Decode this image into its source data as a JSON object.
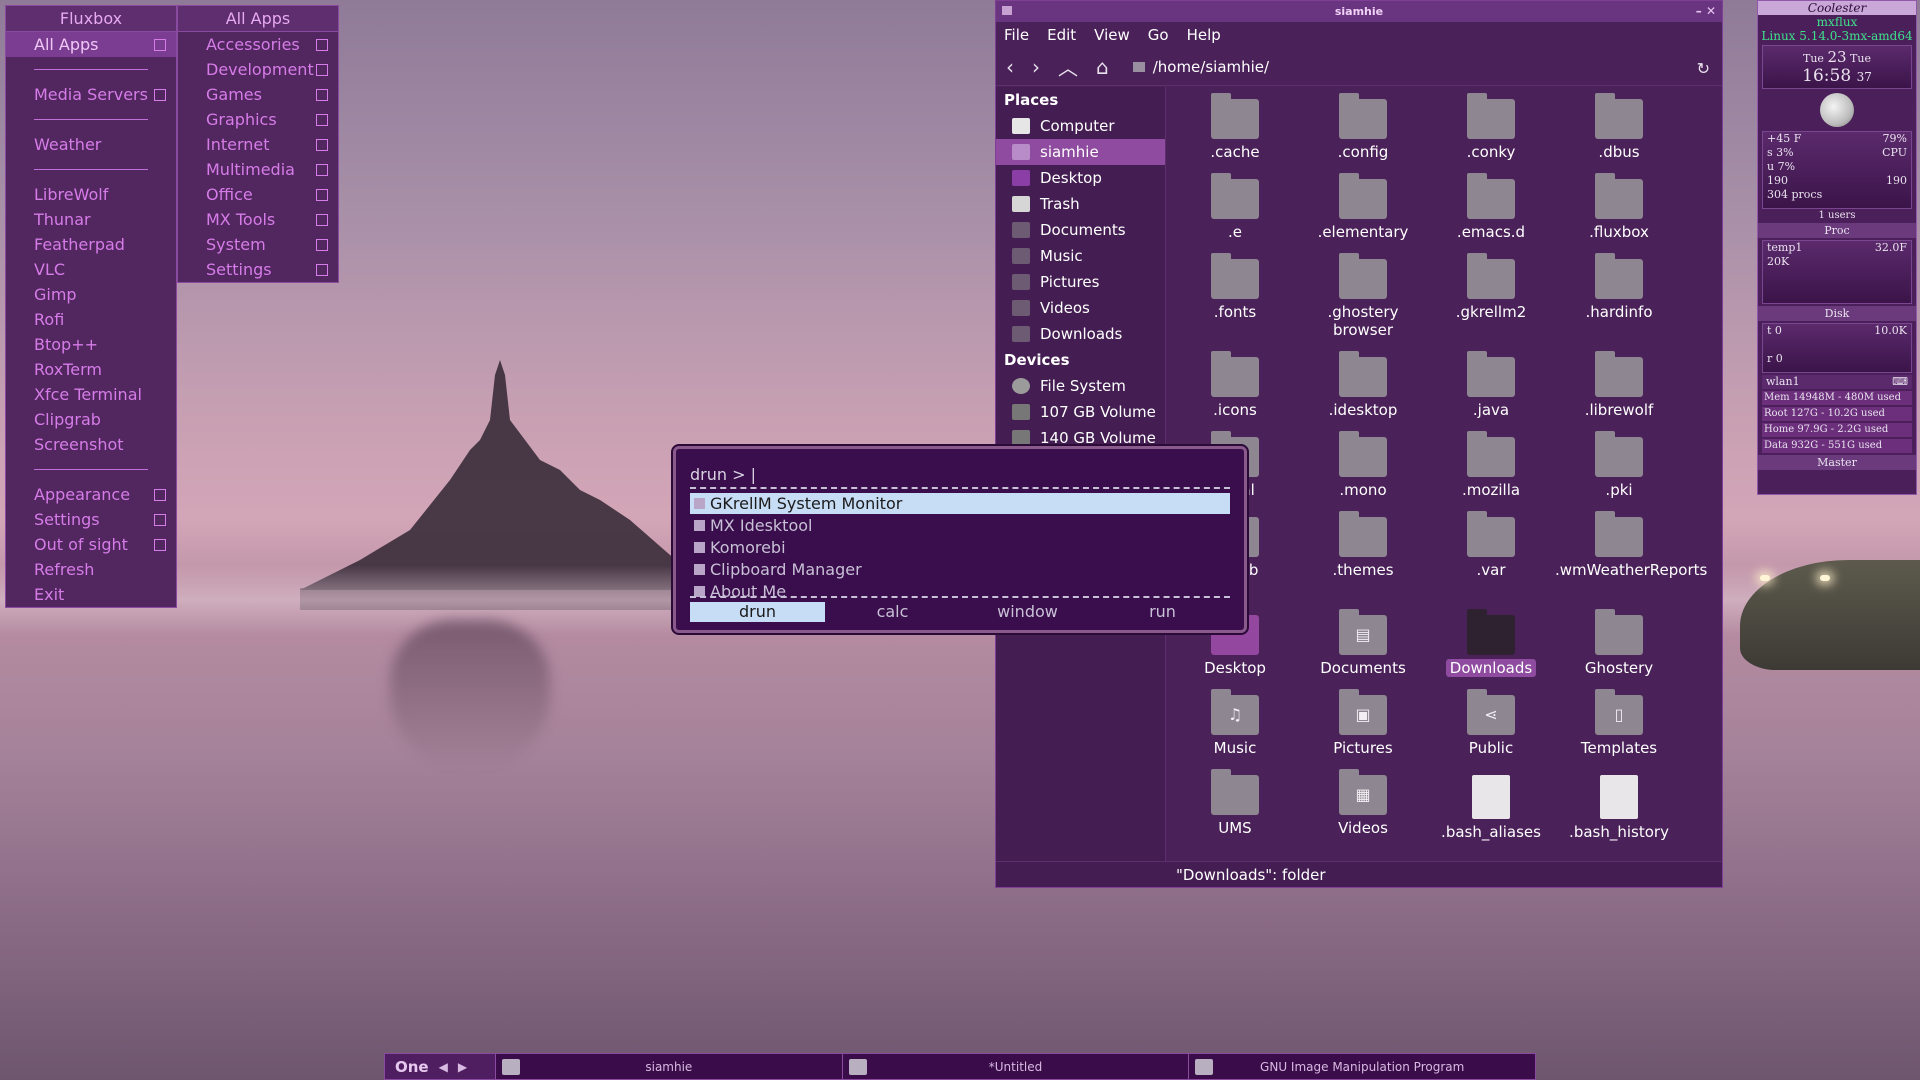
{
  "fluxbox_menu": {
    "title": "Fluxbox",
    "items": [
      {
        "label": "All Apps",
        "sub": true,
        "selected": true
      },
      {
        "sep": true
      },
      {
        "label": "Media Servers",
        "sub": true
      },
      {
        "sep": true
      },
      {
        "label": "Weather"
      },
      {
        "sep": true
      },
      {
        "label": "LibreWolf"
      },
      {
        "label": "Thunar"
      },
      {
        "label": "Featherpad"
      },
      {
        "label": "VLC"
      },
      {
        "label": "Gimp"
      },
      {
        "label": "Rofi"
      },
      {
        "label": "Btop++"
      },
      {
        "label": "RoxTerm"
      },
      {
        "label": "Xfce Terminal"
      },
      {
        "label": "Clipgrab"
      },
      {
        "label": "Screenshot"
      },
      {
        "sep": true
      },
      {
        "label": "Appearance",
        "sub": true
      },
      {
        "label": "Settings",
        "sub": true
      },
      {
        "label": "Out of sight",
        "sub": true
      },
      {
        "label": "Refresh"
      },
      {
        "label": "Exit"
      }
    ]
  },
  "allapps_menu": {
    "title": "All Apps",
    "items": [
      "Accessories",
      "Development",
      "Games",
      "Graphics",
      "Internet",
      "Multimedia",
      "Office",
      "MX Tools",
      "System",
      "Settings"
    ]
  },
  "file_manager": {
    "window_title": "siamhie",
    "menubar": [
      "File",
      "Edit",
      "View",
      "Go",
      "Help"
    ],
    "path": "/home/siamhie/",
    "places_heading": "Places",
    "places": [
      {
        "label": "Computer",
        "icon": "computer-icon"
      },
      {
        "label": "siamhie",
        "icon": "home-icon",
        "selected": true
      },
      {
        "label": "Desktop",
        "icon": "desktop-icon"
      },
      {
        "label": "Trash",
        "icon": "trash-icon"
      },
      {
        "label": "Documents",
        "icon": "folder-icon"
      },
      {
        "label": "Music",
        "icon": "folder-icon"
      },
      {
        "label": "Pictures",
        "icon": "folder-icon"
      },
      {
        "label": "Videos",
        "icon": "folder-icon"
      },
      {
        "label": "Downloads",
        "icon": "folder-icon"
      }
    ],
    "devices_heading": "Devices",
    "devices": [
      {
        "label": "File System",
        "icon": "disk-icon"
      },
      {
        "label": "107 GB Volume",
        "icon": "drive-icon"
      },
      {
        "label": "140 GB Volume",
        "icon": "drive-icon"
      }
    ],
    "files": [
      {
        "name": ".cache",
        "kind": "folder"
      },
      {
        "name": ".config",
        "kind": "folder"
      },
      {
        "name": ".conky",
        "kind": "folder"
      },
      {
        "name": ".dbus",
        "kind": "folder"
      },
      {
        "name": ".e",
        "kind": "folder"
      },
      {
        "name": ".elementary",
        "kind": "folder"
      },
      {
        "name": ".emacs.d",
        "kind": "folder"
      },
      {
        "name": ".fluxbox",
        "kind": "folder"
      },
      {
        "name": ".fonts",
        "kind": "folder"
      },
      {
        "name": ".ghostery browser",
        "kind": "folder"
      },
      {
        "name": ".gkrellm2",
        "kind": "folder"
      },
      {
        "name": ".hardinfo",
        "kind": "folder"
      },
      {
        "name": ".icons",
        "kind": "folder"
      },
      {
        "name": ".idesktop",
        "kind": "folder"
      },
      {
        "name": ".java",
        "kind": "folder"
      },
      {
        "name": ".librewolf",
        "kind": "folder"
      },
      {
        "name": ".local",
        "kind": "folder"
      },
      {
        "name": ".mono",
        "kind": "folder"
      },
      {
        "name": ".mozilla",
        "kind": "folder"
      },
      {
        "name": ".pki",
        "kind": "folder"
      },
      {
        "name": ".rcxdb",
        "kind": "folder"
      },
      {
        "name": ".themes",
        "kind": "folder"
      },
      {
        "name": ".var",
        "kind": "folder"
      },
      {
        "name": ".wmWeatherReports",
        "kind": "folder"
      },
      {
        "name": "Desktop",
        "kind": "folder-purple"
      },
      {
        "name": "Documents",
        "kind": "folder",
        "glyph": "▤"
      },
      {
        "name": "Downloads",
        "kind": "folder-dark",
        "selected": true
      },
      {
        "name": "Ghostery",
        "kind": "folder"
      },
      {
        "name": "Music",
        "kind": "folder",
        "glyph": "♫"
      },
      {
        "name": "Pictures",
        "kind": "folder",
        "glyph": "▣"
      },
      {
        "name": "Public",
        "kind": "folder",
        "glyph": "⋖"
      },
      {
        "name": "Templates",
        "kind": "folder",
        "glyph": "▯"
      },
      {
        "name": "UMS",
        "kind": "folder"
      },
      {
        "name": "Videos",
        "kind": "folder",
        "glyph": "▦"
      },
      {
        "name": ".bash_aliases",
        "kind": "doc"
      },
      {
        "name": ".bash_history",
        "kind": "doc"
      }
    ],
    "status": "\"Downloads\": folder"
  },
  "rofi": {
    "prompt": "drun >",
    "items": [
      {
        "label": "GKrellM System Monitor",
        "selected": true
      },
      {
        "label": "MX Idesktool"
      },
      {
        "label": "Komorebi"
      },
      {
        "label": "Clipboard Manager"
      },
      {
        "label": "About Me"
      }
    ],
    "modes": [
      {
        "label": "drun",
        "selected": true
      },
      {
        "label": "calc"
      },
      {
        "label": "window"
      },
      {
        "label": "run"
      }
    ]
  },
  "gkrellm": {
    "header": "Coolester",
    "hostname": "mxflux",
    "kernel": "Linux 5.14.0-3mx-amd64",
    "day": "Tue",
    "date": "23",
    "month": "Tue",
    "time": "16:58",
    "seconds": "37",
    "temp": "+45 F",
    "humidity": "79%",
    "cpu_label": "CPU",
    "cpu_s": "s 3%",
    "cpu_u": "u 7%",
    "proc_top_left": "190",
    "proc_top_right": "190",
    "procs": "304 procs",
    "users": "1 users",
    "proc_section": "Proc",
    "sensor_name": "temp1",
    "sensor_value": "32.0F",
    "sensor_small": "20K",
    "disk_section": "Disk",
    "disk_t": "t 0",
    "disk_rate": "10.0K",
    "disk_r": "r 0",
    "net": "wlan1",
    "mem": "Mem 14948M - 480M used",
    "root": "Root 127G - 10.2G used",
    "home": "Home 97.9G - 2.2G used",
    "data": "Data 932G - 551G used",
    "mixer": "Master"
  },
  "taskbar": {
    "workspace": "One",
    "tasks": [
      {
        "label": "siamhie",
        "icon": "folder-icon"
      },
      {
        "label": "*Untitled",
        "icon": "featherpad-icon"
      },
      {
        "label": "GNU Image Manipulation Program",
        "icon": "gimp-icon"
      }
    ]
  }
}
